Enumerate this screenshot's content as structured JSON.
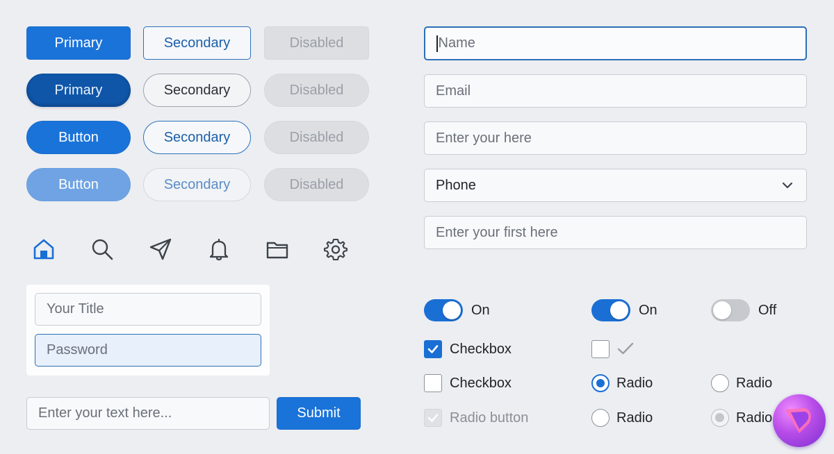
{
  "buttons": {
    "row1": {
      "primary": "Primary",
      "secondary": "Secondary",
      "disabled": "Disabled"
    },
    "row2": {
      "primary": "Primary",
      "secondary": "Secondary",
      "disabled": "Disabled"
    },
    "row3": {
      "primary": "Button",
      "secondary": "Secondary",
      "disabled": "Disabled"
    },
    "row4": {
      "primary": "Button",
      "secondary": "Secondary",
      "disabled": "Disabled"
    }
  },
  "icons": [
    "home-icon",
    "search-icon",
    "send-icon",
    "bell-icon",
    "folder-icon",
    "gear-icon"
  ],
  "login": {
    "title_placeholder": "Your Title",
    "password_placeholder": "Password"
  },
  "text_entry": {
    "placeholder": "Enter your text here...",
    "submit_label": "Submit"
  },
  "form": {
    "name_placeholder": "Name",
    "email_placeholder": "Email",
    "enter_placeholder": "Enter your here",
    "phone_value": "Phone",
    "first_placeholder": "Enter your first here"
  },
  "toggles": [
    {
      "label": "On",
      "state": "on"
    },
    {
      "label": "On",
      "state": "on"
    },
    {
      "label": "Off",
      "state": "off"
    }
  ],
  "checks": {
    "checkbox_checked": "Checkbox",
    "checkbox_empty": "Checkbox",
    "radio_button_disabled": "Radio button",
    "radio1": "Radio",
    "radio2": "Radio",
    "radio3": "Radio",
    "radio4": "Radio"
  },
  "colors": {
    "accent": "#1a73d9",
    "accent_dark": "#0f56a8",
    "background": "#eceef2"
  }
}
